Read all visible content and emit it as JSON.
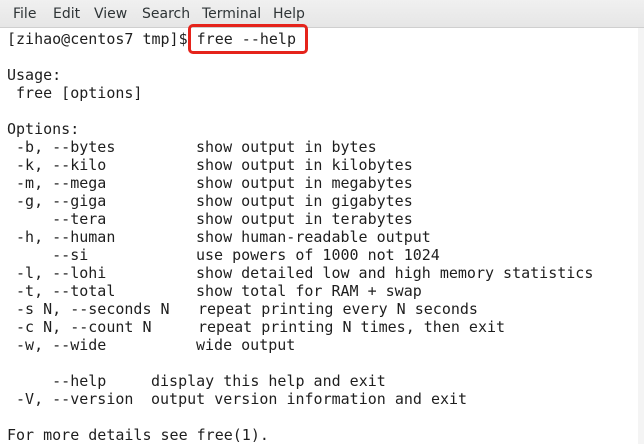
{
  "menubar": {
    "items": [
      "File",
      "Edit",
      "View",
      "Search",
      "Terminal",
      "Help"
    ]
  },
  "terminal": {
    "prompt": "[zihao@centos7 tmp]$ ",
    "command": "free --help",
    "usage_header": "Usage:",
    "usage_line": " free [options]",
    "options_header": "Options:",
    "options": [
      {
        "flag": " -b, --bytes",
        "desc": "show output in bytes"
      },
      {
        "flag": " -k, --kilo",
        "desc": "show output in kilobytes"
      },
      {
        "flag": " -m, --mega",
        "desc": "show output in megabytes"
      },
      {
        "flag": " -g, --giga",
        "desc": "show output in gigabytes"
      },
      {
        "flag": "     --tera",
        "desc": "show output in terabytes"
      },
      {
        "flag": " -h, --human",
        "desc": "show human-readable output"
      },
      {
        "flag": "     --si",
        "desc": "use powers of 1000 not 1024"
      },
      {
        "flag": " -l, --lohi",
        "desc": "show detailed low and high memory statistics"
      },
      {
        "flag": " -t, --total",
        "desc": "show total for RAM + swap"
      },
      {
        "flag": " -s N, --seconds N",
        "desc": "repeat printing every N seconds"
      },
      {
        "flag": " -c N, --count N",
        "desc": "repeat printing N times, then exit"
      },
      {
        "flag": " -w, --wide",
        "desc": "wide output"
      }
    ],
    "help_options": [
      {
        "flag": "     --help",
        "desc": "display this help and exit"
      },
      {
        "flag": " -V, --version",
        "desc": "output version information and exit"
      }
    ],
    "footer": "For more details see free(1)."
  },
  "colors": {
    "highlight_box": "#e5231b",
    "text": "#1e1e1e",
    "background": "#ffffff"
  }
}
